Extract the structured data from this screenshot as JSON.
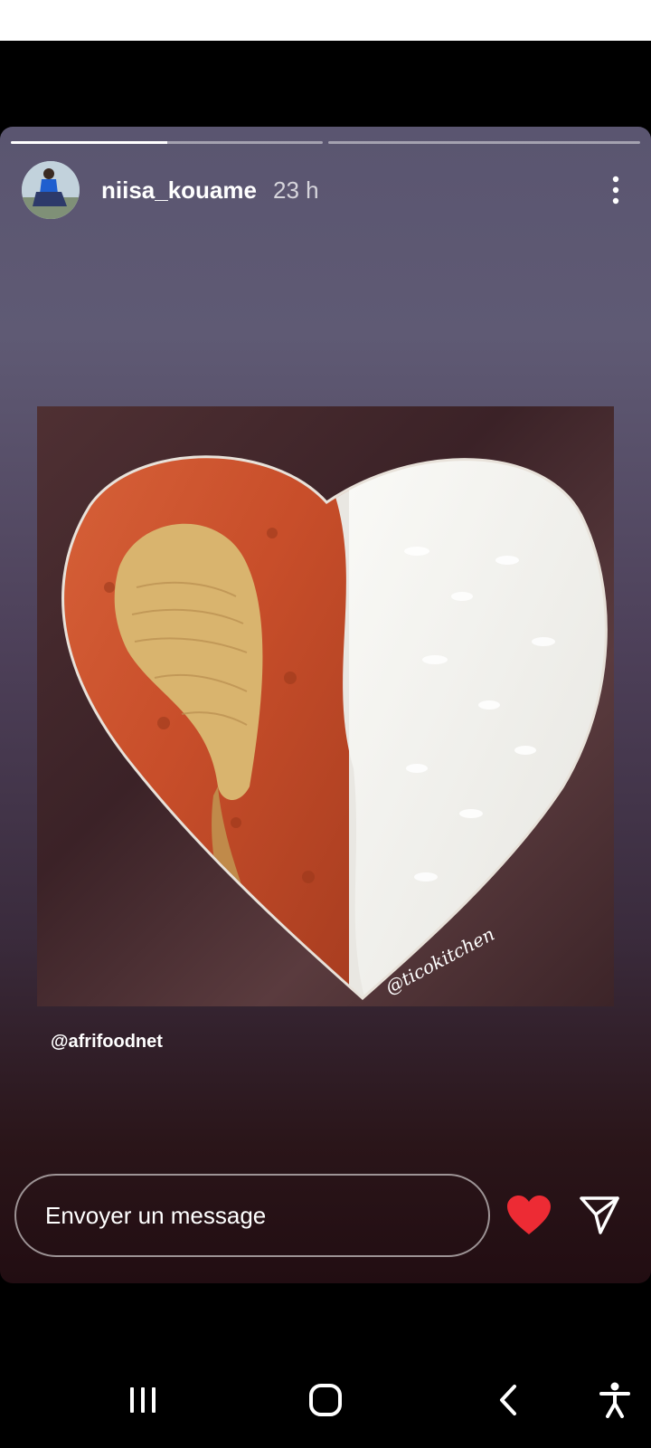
{
  "story": {
    "username": "niisa_kouame",
    "time": "23 h",
    "segments": [
      {
        "progress": 0.5
      },
      {
        "progress": 0
      }
    ],
    "mention": "@afrifoodnet",
    "photo_watermark": "@ticokitchen",
    "message_placeholder": "Envoyer un message"
  },
  "icons": {
    "menu": "more-vertical-icon",
    "like": "heart-icon",
    "send": "send-icon"
  },
  "navbar": {
    "recent": "recent-apps-icon",
    "home": "home-icon",
    "back": "back-icon",
    "accessibility": "accessibility-icon"
  },
  "colors": {
    "heart": "#ed2b34",
    "text": "#ffffff"
  }
}
